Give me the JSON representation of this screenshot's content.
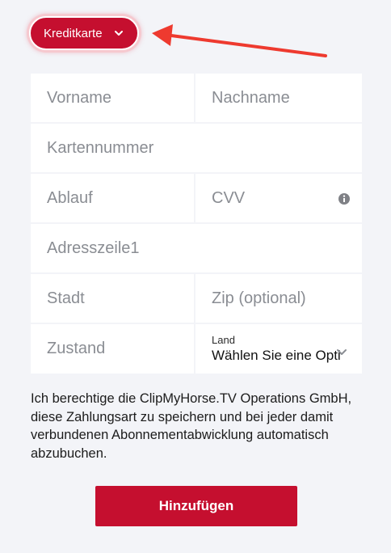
{
  "payment_method": {
    "selected_label": "Kreditkarte",
    "chevron_icon": "chevron-down-icon"
  },
  "form": {
    "first_name_placeholder": "Vorname",
    "last_name_placeholder": "Nachname",
    "card_number_placeholder": "Kartennummer",
    "expiry_placeholder": "Ablauf",
    "cvv_placeholder": "CVV",
    "cvv_info_icon": "info-icon",
    "address_placeholder": "Adresszeile1",
    "city_placeholder": "Stadt",
    "zip_placeholder": "Zip (optional)",
    "state_placeholder": "Zustand",
    "country_label": "Land",
    "country_value": "Wählen Sie eine Opti"
  },
  "consent_text": "Ich berechtige die ClipMyHorse.TV Operations GmbH, diese Zahlungsart zu speichern und bei jeder damit verbundenen Abonnementabwicklung automatisch abzubuchen.",
  "submit_label": "Hinzufügen",
  "colors": {
    "accent": "#c50f2f",
    "background": "#f3f4f8",
    "annotation_arrow": "#ee3a2f"
  }
}
